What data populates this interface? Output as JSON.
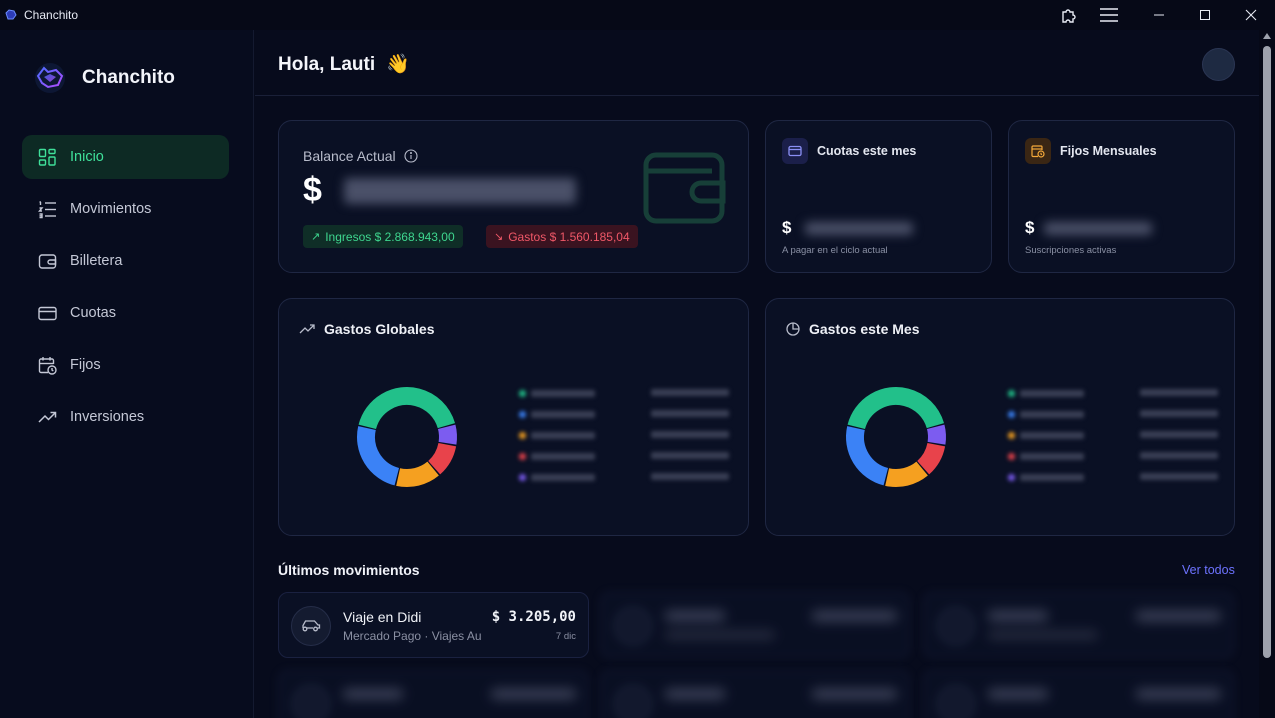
{
  "window": {
    "title": "Chanchito"
  },
  "sidebar": {
    "brand": "Chanchito",
    "items": [
      {
        "label": "Inicio",
        "icon": "grid-icon",
        "active": true
      },
      {
        "label": "Movimientos",
        "icon": "list-icon"
      },
      {
        "label": "Billetera",
        "icon": "wallet-icon"
      },
      {
        "label": "Cuotas",
        "icon": "credit-card-icon"
      },
      {
        "label": "Fijos",
        "icon": "calendar-clock-icon"
      },
      {
        "label": "Inversiones",
        "icon": "trending-up-icon"
      }
    ]
  },
  "header": {
    "greeting": "Hola, Lauti",
    "emoji": "👋"
  },
  "balance": {
    "label": "Balance Actual",
    "currency": "$",
    "income": "Ingresos $ 2.868.943,00",
    "expense": "Gastos $ 1.560.185,04"
  },
  "cuotas": {
    "title": "Cuotas este mes",
    "currency": "$",
    "sub": "A pagar en el ciclo actual"
  },
  "fijos": {
    "title": "Fijos Mensuales",
    "currency": "$",
    "sub": "Suscripciones activas"
  },
  "charts": {
    "global": {
      "title": "Gastos Globales",
      "segments": [
        {
          "color": "#22c08a",
          "value": 0.42
        },
        {
          "color": "#7c5cf0",
          "value": 0.07
        },
        {
          "color": "#e8434b",
          "value": 0.11
        },
        {
          "color": "#f5a020",
          "value": 0.15
        },
        {
          "color": "#3b82f6",
          "value": 0.25
        }
      ],
      "legend_colors": [
        "#22c08a",
        "#3b82f6",
        "#f5a020",
        "#e8434b",
        "#7c5cf0"
      ]
    },
    "month": {
      "title": "Gastos este Mes",
      "segments": [
        {
          "color": "#22c08a",
          "value": 0.42
        },
        {
          "color": "#7c5cf0",
          "value": 0.07
        },
        {
          "color": "#e8434b",
          "value": 0.11
        },
        {
          "color": "#f5a020",
          "value": 0.15
        },
        {
          "color": "#3b82f6",
          "value": 0.25
        }
      ],
      "legend_colors": [
        "#22c08a",
        "#3b82f6",
        "#f5a020",
        "#e8434b",
        "#7c5cf0"
      ]
    }
  },
  "movements": {
    "title": "Últimos movimientos",
    "see_all": "Ver todos",
    "first": {
      "title": "Viaje en Didi",
      "sub": "Mercado Pago · Viajes Au",
      "amount": "$ 3.205,00",
      "date": "7 dic"
    }
  },
  "colors": {
    "accent": "#3fe09a",
    "link": "#6d73ff",
    "income": "#3ed68f",
    "expense": "#f05868"
  }
}
